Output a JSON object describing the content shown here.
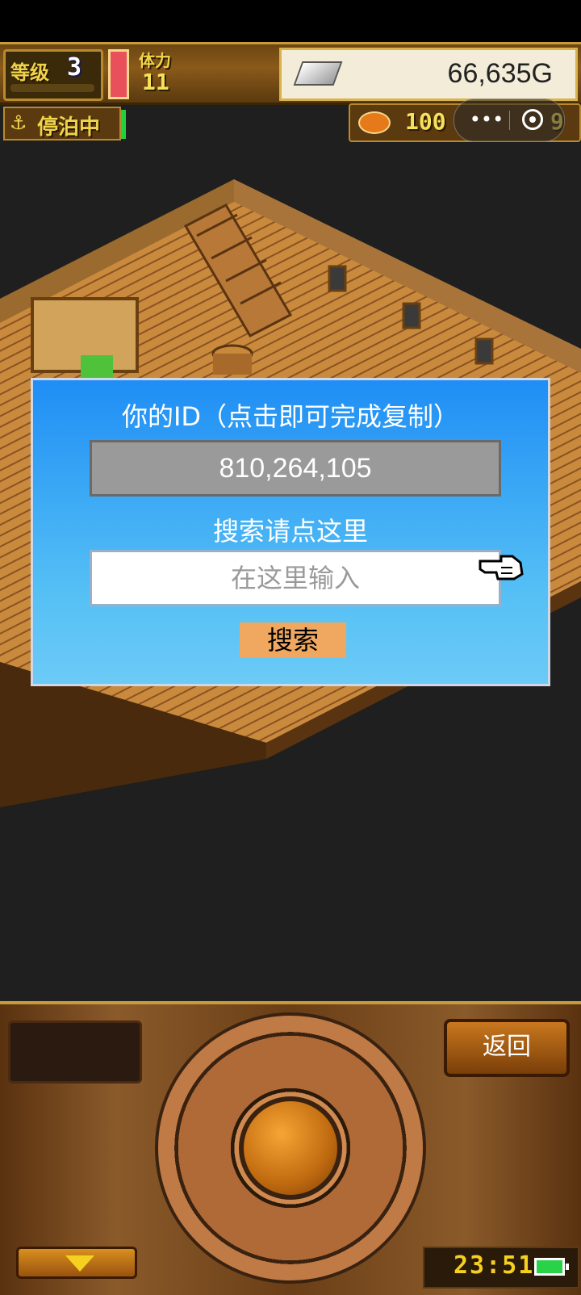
{
  "hud": {
    "level_label": "等级",
    "level_value": "3",
    "stamina_label": "体力",
    "stamina_value": "11",
    "gold_value": "66,635G",
    "status_label": "停泊中",
    "resource_value": "100",
    "resource_value_2": "9",
    "silver_icon": "silver-ingot-icon",
    "fish_icon": "fish-icon"
  },
  "dialog": {
    "title": "你的ID（点击即可完成复制）",
    "id_value": "810,264,105",
    "search_label": "搜索请点这里",
    "search_placeholder": "在这里输入",
    "search_button": "搜索"
  },
  "controls": {
    "back_label": "返回",
    "clock": "23:51"
  },
  "colors": {
    "dialog_top": "#1f8ef5",
    "dialog_bottom": "#6ccaf6",
    "search_button": "#f0a860",
    "hud_text": "#f0d34a"
  }
}
